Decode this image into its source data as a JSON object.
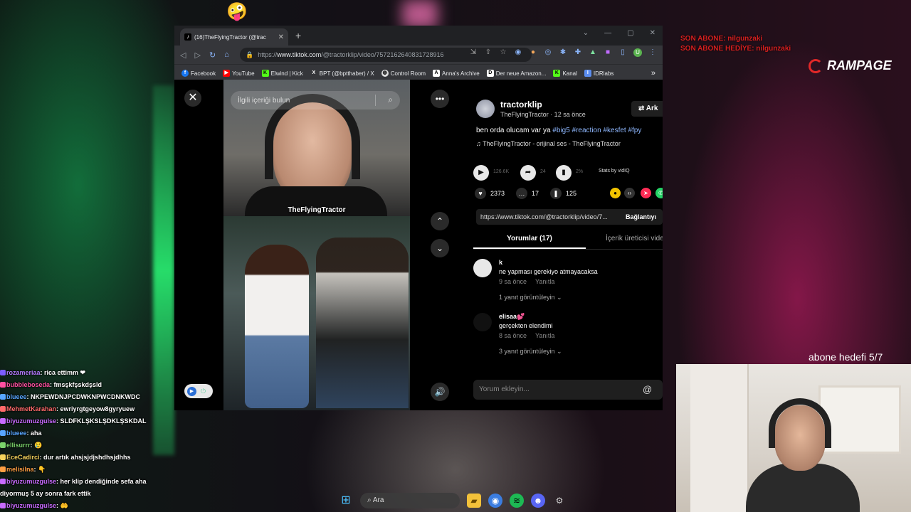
{
  "browser": {
    "tab_title": "(16)TheFlyingTractor (@trac",
    "url_scheme": "https://",
    "url_host": "www.tiktok.com",
    "url_path": "/@tractorklip/video/7572162640831728916",
    "bookmarks": [
      "Facebook",
      "YouTube",
      "Elwind | Kick",
      "BPT (@bptthaber) / X",
      "Control Room",
      "Anna's Archive",
      "Der neue Amazon...",
      "Kanal",
      "IDRlabs"
    ],
    "bookmark_more": "»"
  },
  "tiktok": {
    "search_placeholder": "İlgili içeriği bulun",
    "video_overlay_name": "TheFlyingTractor",
    "author_username": "tractorklip",
    "author_sub": "TheFlyingTractor · 12 sa önce",
    "follow_label": "⇄ Ark",
    "description_text": "ben orda olucam var ya ",
    "hashtags": "#big5 #reaction #kesfet #fpy",
    "music": "TheFlyingTractor - orijinal ses - TheFlyingTractor",
    "plays_dim": "126.6K",
    "shares_dim": "24",
    "percent_dim": "2%",
    "stats_label": "Stats by vidIQ",
    "likes": "2373",
    "comments_count": "17",
    "saves": "125",
    "link": "https://www.tiktok.com/@tractorklip/video/7...",
    "copy_link": "Bağlantıyı",
    "tab_comments": "Yorumlar (17)",
    "tab_creator": "İçerik üreticisi vide",
    "comments": [
      {
        "name": "k",
        "text": "ne yapması gerekiyo atmayacaksa",
        "time": "9 sa önce",
        "reply": "Yanıtla",
        "replies": "1 yanıt görüntüleyin ⌄"
      },
      {
        "name": "elisaa💕",
        "text": "gerçekten elendimi",
        "time": "8 sa önce",
        "reply": "Yanıtla",
        "replies": "3 yanıt görüntüleyin ⌄"
      }
    ],
    "comment_placeholder": "Yorum ekleyin...",
    "at_symbol": "@"
  },
  "overlay": {
    "sub_line1": "SON ABONE: nilgunzaki",
    "sub_line2": "SON ABONE HEDİYE: nilgunzaki",
    "brand": "RAMPAGE",
    "goal": "abone hedefi 5/7"
  },
  "chat": [
    {
      "user": "rozameriaa",
      "msg": ": rica ettimm ❤",
      "color": "#b57bff"
    },
    {
      "user": "bubbleboseda",
      "msg": ": fmsşkfşskdşsld",
      "color": "#ff4fa0"
    },
    {
      "user": "blueee",
      "msg": ": NKPEWDNJPCDWKNPWCDNKWDC",
      "color": "#58a6ff"
    },
    {
      "user": "MehmetKarahan",
      "msg": ": ewriyrgtgeyow8gyryuew",
      "color": "#ff6b6b"
    },
    {
      "user": "biyuzumuzgulse",
      "msg": ": SLDFKLŞKSLŞDKLŞSKDAL",
      "color": "#c86bff"
    },
    {
      "user": "blueee",
      "msg": ": aha",
      "color": "#58a6ff"
    },
    {
      "user": "ellisurrr",
      "msg": ": 😢",
      "color": "#7bd36b"
    },
    {
      "user": "EceCadirci",
      "msg": ": dur artık ahsjsjdjshdhsjdhhs",
      "color": "#f5d25c"
    },
    {
      "user": "melisilna",
      "msg": ": 👇",
      "color": "#ff9f43"
    },
    {
      "user": "biyuzumuzgulse",
      "msg": ": her klip dendiğinde sefa aha",
      "color": "#c86bff"
    },
    {
      "user": "",
      "msg": "diyormuş 5 ay sonra fark ettik",
      "color": "#ffffff"
    },
    {
      "user": "biyuzumuzgulse",
      "msg": ": 🤲",
      "color": "#c86bff"
    }
  ],
  "taskbar": {
    "search": "Ara"
  },
  "colors": {
    "accent_blue": "#8fb8ff",
    "brand_red": "#e12828"
  }
}
